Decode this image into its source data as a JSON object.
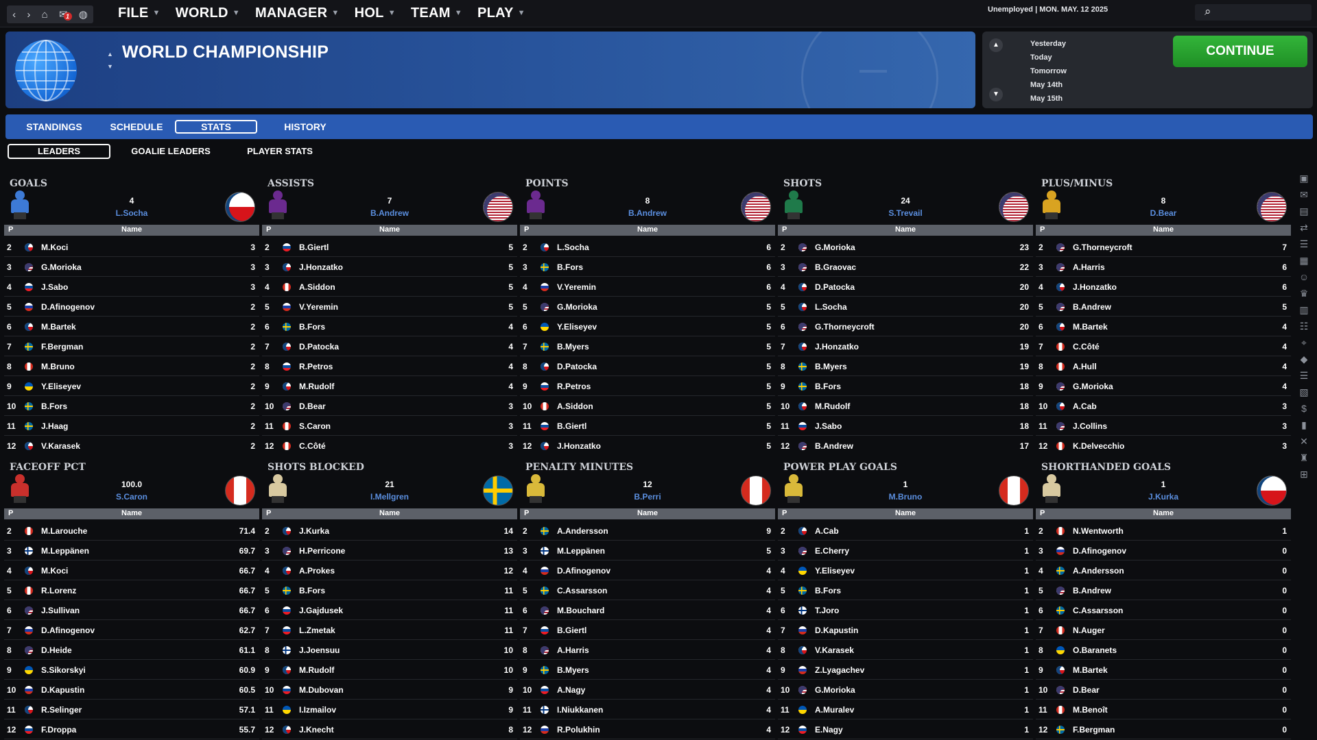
{
  "topbar": {
    "nav_icons": [
      "back-icon",
      "forward-icon",
      "home-icon",
      "mail-icon",
      "globe-icon"
    ],
    "mail_badge": "1",
    "menu": [
      "FILE",
      "WORLD",
      "MANAGER",
      "HOL",
      "TEAM",
      "PLAY"
    ],
    "status": "Unemployed | MON. MAY. 12 2025"
  },
  "header": {
    "title": "WORLD CHAMPIONSHIP",
    "dates": [
      "Yesterday",
      "Today",
      "Tomorrow",
      "May 14th",
      "May 15th"
    ],
    "continue_label": "CONTINUE"
  },
  "tabs": [
    "STANDINGS",
    "SCHEDULE",
    "STATS",
    "HISTORY"
  ],
  "active_tab": "STATS",
  "subtabs": [
    "LEADERS",
    "GOALIE LEADERS",
    "PLAYER STATS"
  ],
  "active_subtab": "LEADERS",
  "table_header": {
    "p": "P",
    "name": "Name"
  },
  "panels": [
    {
      "title": "GOALS",
      "leader": {
        "value": "4",
        "name": "L.Socha",
        "flag": "cz",
        "color": "#3d7ad6"
      },
      "rows": [
        [
          "2",
          "cz",
          "M.Koci",
          "3"
        ],
        [
          "3",
          "us",
          "G.Morioka",
          "3"
        ],
        [
          "4",
          "sk",
          "J.Sabo",
          "3"
        ],
        [
          "5",
          "ru",
          "D.Afinogenov",
          "2"
        ],
        [
          "6",
          "cz",
          "M.Bartek",
          "2"
        ],
        [
          "7",
          "se",
          "F.Bergman",
          "2"
        ],
        [
          "8",
          "ca",
          "M.Bruno",
          "2"
        ],
        [
          "9",
          "ua",
          "Y.Eliseyev",
          "2"
        ],
        [
          "10",
          "se",
          "B.Fors",
          "2"
        ],
        [
          "11",
          "se",
          "J.Haag",
          "2"
        ],
        [
          "12",
          "cz",
          "V.Karasek",
          "2"
        ]
      ]
    },
    {
      "title": "ASSISTS",
      "leader": {
        "value": "7",
        "name": "B.Andrew",
        "flag": "us",
        "color": "#6b2a8f"
      },
      "rows": [
        [
          "2",
          "sk",
          "B.Giertl",
          "5"
        ],
        [
          "3",
          "cz",
          "J.Honzatko",
          "5"
        ],
        [
          "4",
          "ca",
          "A.Siddon",
          "5"
        ],
        [
          "5",
          "ru",
          "V.Yeremin",
          "5"
        ],
        [
          "6",
          "se",
          "B.Fors",
          "4"
        ],
        [
          "7",
          "cz",
          "D.Patocka",
          "4"
        ],
        [
          "8",
          "sk",
          "R.Petros",
          "4"
        ],
        [
          "9",
          "cz",
          "M.Rudolf",
          "4"
        ],
        [
          "10",
          "us",
          "D.Bear",
          "3"
        ],
        [
          "11",
          "ca",
          "S.Caron",
          "3"
        ],
        [
          "12",
          "ca",
          "C.Côté",
          "3"
        ]
      ]
    },
    {
      "title": "POINTS",
      "leader": {
        "value": "8",
        "name": "B.Andrew",
        "flag": "us",
        "color": "#6b2a8f"
      },
      "rows": [
        [
          "2",
          "cz",
          "L.Socha",
          "6"
        ],
        [
          "3",
          "se",
          "B.Fors",
          "6"
        ],
        [
          "4",
          "ru",
          "V.Yeremin",
          "6"
        ],
        [
          "5",
          "us",
          "G.Morioka",
          "5"
        ],
        [
          "6",
          "ua",
          "Y.Eliseyev",
          "5"
        ],
        [
          "7",
          "se",
          "B.Myers",
          "5"
        ],
        [
          "8",
          "cz",
          "D.Patocka",
          "5"
        ],
        [
          "9",
          "sk",
          "R.Petros",
          "5"
        ],
        [
          "10",
          "ca",
          "A.Siddon",
          "5"
        ],
        [
          "11",
          "sk",
          "B.Giertl",
          "5"
        ],
        [
          "12",
          "cz",
          "J.Honzatko",
          "5"
        ]
      ]
    },
    {
      "title": "SHOTS",
      "leader": {
        "value": "24",
        "name": "S.Trevail",
        "flag": "us",
        "color": "#1f7a4a"
      },
      "rows": [
        [
          "2",
          "us",
          "G.Morioka",
          "23"
        ],
        [
          "3",
          "us",
          "B.Graovac",
          "22"
        ],
        [
          "4",
          "cz",
          "D.Patocka",
          "20"
        ],
        [
          "5",
          "cz",
          "L.Socha",
          "20"
        ],
        [
          "6",
          "us",
          "G.Thorneycroft",
          "20"
        ],
        [
          "7",
          "cz",
          "J.Honzatko",
          "19"
        ],
        [
          "8",
          "se",
          "B.Myers",
          "19"
        ],
        [
          "9",
          "se",
          "B.Fors",
          "18"
        ],
        [
          "10",
          "cz",
          "M.Rudolf",
          "18"
        ],
        [
          "11",
          "sk",
          "J.Sabo",
          "18"
        ],
        [
          "12",
          "us",
          "B.Andrew",
          "17"
        ]
      ]
    },
    {
      "title": "PLUS/MINUS",
      "leader": {
        "value": "8",
        "name": "D.Bear",
        "flag": "us",
        "color": "#d9a321"
      },
      "rows": [
        [
          "2",
          "us",
          "G.Thorneycroft",
          "7"
        ],
        [
          "3",
          "us",
          "A.Harris",
          "6"
        ],
        [
          "4",
          "cz",
          "J.Honzatko",
          "6"
        ],
        [
          "5",
          "us",
          "B.Andrew",
          "5"
        ],
        [
          "6",
          "cz",
          "M.Bartek",
          "4"
        ],
        [
          "7",
          "ca",
          "C.Côté",
          "4"
        ],
        [
          "8",
          "ca",
          "A.Hull",
          "4"
        ],
        [
          "9",
          "us",
          "G.Morioka",
          "4"
        ],
        [
          "10",
          "cz",
          "A.Cab",
          "3"
        ],
        [
          "11",
          "us",
          "J.Collins",
          "3"
        ],
        [
          "12",
          "ca",
          "K.Delvecchio",
          "3"
        ]
      ]
    },
    {
      "title": "FACEOFF PCT",
      "leader": {
        "value": "100.0",
        "name": "S.Caron",
        "flag": "ca",
        "color": "#c9302c"
      },
      "rows": [
        [
          "2",
          "ca",
          "M.Larouche",
          "71.4"
        ],
        [
          "3",
          "fi",
          "M.Leppänen",
          "69.7"
        ],
        [
          "4",
          "cz",
          "M.Koci",
          "66.7"
        ],
        [
          "5",
          "ca",
          "R.Lorenz",
          "66.7"
        ],
        [
          "6",
          "us",
          "J.Sullivan",
          "66.7"
        ],
        [
          "7",
          "ru",
          "D.Afinogenov",
          "62.7"
        ],
        [
          "8",
          "us",
          "D.Heide",
          "61.1"
        ],
        [
          "9",
          "ua",
          "S.Sikorskyi",
          "60.9"
        ],
        [
          "10",
          "ru",
          "D.Kapustin",
          "60.5"
        ],
        [
          "11",
          "cz",
          "R.Selinger",
          "57.1"
        ],
        [
          "12",
          "sk",
          "F.Droppa",
          "55.7"
        ]
      ]
    },
    {
      "title": "SHOTS BLOCKED",
      "leader": {
        "value": "21",
        "name": "I.Mellgren",
        "flag": "se",
        "color": "#d8c9a0"
      },
      "rows": [
        [
          "2",
          "cz",
          "J.Kurka",
          "14"
        ],
        [
          "3",
          "us",
          "H.Perricone",
          "13"
        ],
        [
          "4",
          "cz",
          "A.Prokes",
          "12"
        ],
        [
          "5",
          "se",
          "B.Fors",
          "11"
        ],
        [
          "6",
          "sk",
          "J.Gajdusek",
          "11"
        ],
        [
          "7",
          "sk",
          "L.Zmetak",
          "11"
        ],
        [
          "8",
          "fi",
          "J.Joensuu",
          "10"
        ],
        [
          "9",
          "cz",
          "M.Rudolf",
          "10"
        ],
        [
          "10",
          "sk",
          "M.Dubovan",
          "9"
        ],
        [
          "11",
          "ua",
          "I.Izmailov",
          "9"
        ],
        [
          "12",
          "cz",
          "J.Knecht",
          "8"
        ]
      ]
    },
    {
      "title": "PENALTY MINUTES",
      "leader": {
        "value": "12",
        "name": "B.Perri",
        "flag": "ca",
        "color": "#d9b93a"
      },
      "rows": [
        [
          "2",
          "se",
          "A.Andersson",
          "9"
        ],
        [
          "3",
          "fi",
          "M.Leppänen",
          "5"
        ],
        [
          "4",
          "ru",
          "D.Afinogenov",
          "4"
        ],
        [
          "5",
          "se",
          "C.Assarsson",
          "4"
        ],
        [
          "6",
          "us",
          "M.Bouchard",
          "4"
        ],
        [
          "7",
          "sk",
          "B.Giertl",
          "4"
        ],
        [
          "8",
          "us",
          "A.Harris",
          "4"
        ],
        [
          "9",
          "se",
          "B.Myers",
          "4"
        ],
        [
          "10",
          "sk",
          "A.Nagy",
          "4"
        ],
        [
          "11",
          "fi",
          "I.Niukkanen",
          "4"
        ],
        [
          "12",
          "ru",
          "R.Polukhin",
          "4"
        ]
      ]
    },
    {
      "title": "POWER PLAY GOALS",
      "leader": {
        "value": "1",
        "name": "M.Bruno",
        "flag": "ca",
        "color": "#d9b93a"
      },
      "rows": [
        [
          "2",
          "cz",
          "A.Cab",
          "1"
        ],
        [
          "3",
          "us",
          "E.Cherry",
          "1"
        ],
        [
          "4",
          "ua",
          "Y.Eliseyev",
          "1"
        ],
        [
          "5",
          "se",
          "B.Fors",
          "1"
        ],
        [
          "6",
          "fi",
          "T.Joro",
          "1"
        ],
        [
          "7",
          "ru",
          "D.Kapustin",
          "1"
        ],
        [
          "8",
          "cz",
          "V.Karasek",
          "1"
        ],
        [
          "9",
          "ru",
          "Z.Lyagachev",
          "1"
        ],
        [
          "10",
          "us",
          "G.Morioka",
          "1"
        ],
        [
          "11",
          "ua",
          "A.Muralev",
          "1"
        ],
        [
          "12",
          "sk",
          "E.Nagy",
          "1"
        ]
      ]
    },
    {
      "title": "SHORTHANDED GOALS",
      "leader": {
        "value": "1",
        "name": "J.Kurka",
        "flag": "cz",
        "color": "#d8c9a0"
      },
      "rows": [
        [
          "2",
          "ca",
          "N.Wentworth",
          "1"
        ],
        [
          "3",
          "ru",
          "D.Afinogenov",
          "0"
        ],
        [
          "4",
          "se",
          "A.Andersson",
          "0"
        ],
        [
          "5",
          "us",
          "B.Andrew",
          "0"
        ],
        [
          "6",
          "se",
          "C.Assarsson",
          "0"
        ],
        [
          "7",
          "ca",
          "N.Auger",
          "0"
        ],
        [
          "8",
          "ua",
          "O.Baranets",
          "0"
        ],
        [
          "9",
          "cz",
          "M.Bartek",
          "0"
        ],
        [
          "10",
          "us",
          "D.Bear",
          "0"
        ],
        [
          "11",
          "ca",
          "M.Benoît",
          "0"
        ],
        [
          "12",
          "se",
          "F.Bergman",
          "0"
        ]
      ]
    }
  ],
  "sidebar_icons": [
    "flag-icon",
    "mail-icon",
    "inbox-icon",
    "transfer-icon",
    "list-icon",
    "calendar-icon",
    "people-icon",
    "trophy-icon",
    "clipboard-icon",
    "staff-icon",
    "scout-icon",
    "hockey-icon",
    "list-icon",
    "roster-icon",
    "finance-icon",
    "chart-icon",
    "tactics-icon",
    "award-icon",
    "league-icon"
  ]
}
